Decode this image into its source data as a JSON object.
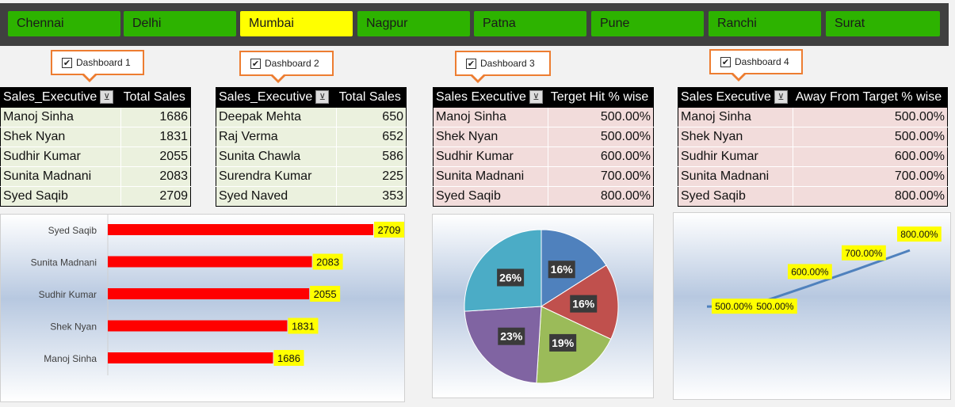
{
  "cities": [
    {
      "label": "Chennai",
      "selected": false
    },
    {
      "label": "Delhi",
      "selected": false
    },
    {
      "label": "Mumbai",
      "selected": true
    },
    {
      "label": "Nagpur",
      "selected": false
    },
    {
      "label": "Patna",
      "selected": false
    },
    {
      "label": "Pune",
      "selected": false
    },
    {
      "label": "Ranchi",
      "selected": false
    },
    {
      "label": "Surat",
      "selected": false
    }
  ],
  "dashboards": [
    {
      "label": "Dashboard 1",
      "checked": true
    },
    {
      "label": "Dashboard 2",
      "checked": true
    },
    {
      "label": "Dashboard 3",
      "checked": true
    },
    {
      "label": "Dashboard 4",
      "checked": true
    }
  ],
  "check_glyph": "✔",
  "filter_glyph": "⊻",
  "tables": {
    "t1": {
      "headers": [
        "Sales_Executive",
        "Total Sales"
      ],
      "rows": [
        [
          "Manoj Sinha",
          "1686"
        ],
        [
          "Shek Nyan",
          "1831"
        ],
        [
          "Sudhir Kumar",
          "2055"
        ],
        [
          "Sunita Madnani",
          "2083"
        ],
        [
          "Syed Saqib",
          "2709"
        ]
      ]
    },
    "t2": {
      "headers": [
        "Sales_Executive",
        "Total Sales"
      ],
      "rows": [
        [
          "Deepak Mehta",
          "650"
        ],
        [
          "Raj Verma",
          "652"
        ],
        [
          "Sunita Chawla",
          "586"
        ],
        [
          "Surendra Kumar",
          "225"
        ],
        [
          "Syed Naved",
          "353"
        ]
      ]
    },
    "t3": {
      "headers": [
        "Sales Executive",
        "Terget Hit % wise"
      ],
      "rows": [
        [
          "Manoj Sinha",
          "500.00%"
        ],
        [
          "Shek Nyan",
          "500.00%"
        ],
        [
          "Sudhir Kumar",
          "600.00%"
        ],
        [
          "Sunita Madnani",
          "700.00%"
        ],
        [
          "Syed Saqib",
          "800.00%"
        ]
      ]
    },
    "t4": {
      "headers": [
        "Sales Executive",
        "Away From Target % wise"
      ],
      "rows": [
        [
          "Manoj Sinha",
          "500.00%"
        ],
        [
          "Shek Nyan",
          "500.00%"
        ],
        [
          "Sudhir Kumar",
          "600.00%"
        ],
        [
          "Sunita Madnani",
          "700.00%"
        ],
        [
          "Syed Saqib",
          "800.00%"
        ]
      ]
    }
  },
  "colors": {
    "city_button": "#2db300",
    "city_selected": "#ffff00",
    "bar": "#ff0000",
    "data_label": "#ffff00",
    "line": "#4f81bd",
    "callout_border": "#ed7d31"
  },
  "chart_data": [
    {
      "type": "bar",
      "orientation": "horizontal",
      "categories": [
        "Syed Saqib",
        "Sunita Madnani",
        "Sudhir Kumar",
        "Shek Nyan",
        "Manoj Sinha"
      ],
      "values": [
        2709,
        2083,
        2055,
        1831,
        1686
      ],
      "xlim": [
        0,
        2709
      ],
      "grid": false,
      "legend": "none"
    },
    {
      "type": "pie",
      "slices": [
        {
          "value": 16,
          "label": "16%",
          "color": "#4f81bd"
        },
        {
          "value": 16,
          "label": "16%",
          "color": "#c0504d"
        },
        {
          "value": 19,
          "label": "19%",
          "color": "#9bbb59"
        },
        {
          "value": 23,
          "label": "23%",
          "color": "#8064a2"
        },
        {
          "value": 26,
          "label": "26%",
          "color": "#4bacc6"
        }
      ],
      "legend": "none"
    },
    {
      "type": "line",
      "values": [
        500,
        500,
        600,
        700,
        800
      ],
      "labels": [
        "500.00%",
        "500.00%",
        "600.00%",
        "700.00%",
        "800.00%"
      ],
      "color": "#4f81bd",
      "grid": false,
      "legend": "none"
    }
  ]
}
